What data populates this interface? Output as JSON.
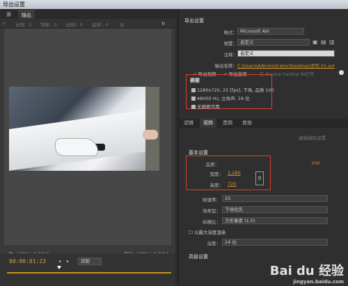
{
  "window": {
    "title": "导出设置"
  },
  "left": {
    "tabs": [
      "源",
      "输出"
    ],
    "toolbar": [
      "左侧：0",
      "顶部：0",
      "右侧：0",
      "底部：0",
      "无"
    ],
    "source_info": "源：1280 w X 720 h",
    "output_info": "输出：1280 w X 720 h",
    "timecode": "00:00:01:23",
    "fit": "适配"
  },
  "export": {
    "section": "导出设置",
    "format_label": "格式：",
    "format_value": "Microsoft AVI",
    "preset_label": "预置：",
    "preset_value": "自定义",
    "comment_label": "注释：",
    "comment_value": "自定义",
    "output_label": "输出名称：",
    "output_value": "C:\\Users\\Administrator\\Desktop\\序列 01.avi",
    "export_video": "导出视频",
    "export_audio": "导出音频",
    "device_central": "在 Device Central 中打开"
  },
  "summary": {
    "title": "摘要",
    "video_line": "1280x720, 25 [fps], 下场, 品质 100",
    "audio_line": "48000 Hz, 立体声, 16 位",
    "no_fx": "无摘要可用"
  },
  "tabs2": [
    "滤镜",
    "视频",
    "音频",
    "其他"
  ],
  "edit_codec": "编辑编码设置",
  "basic": {
    "section": "基本设置",
    "quality_label": "品质：",
    "quality_value": "100",
    "width_label": "宽度：",
    "width_value": "1,280",
    "height_label": "高度：",
    "height_value": "720",
    "fps_label": "帧速率：",
    "fps_value": "25",
    "field_label": "场类型：",
    "field_value": "下场优先",
    "aspect_label": "纵横比：",
    "aspect_value": "方形像素 (1.0)",
    "max_depth": "以最大深度渲染",
    "depth_label": "深度：",
    "depth_value": "24 位"
  },
  "advanced": {
    "section": "高级设置"
  },
  "watermark": {
    "main": "Bai du 经验",
    "sub": "jingyan.baidu.com"
  }
}
